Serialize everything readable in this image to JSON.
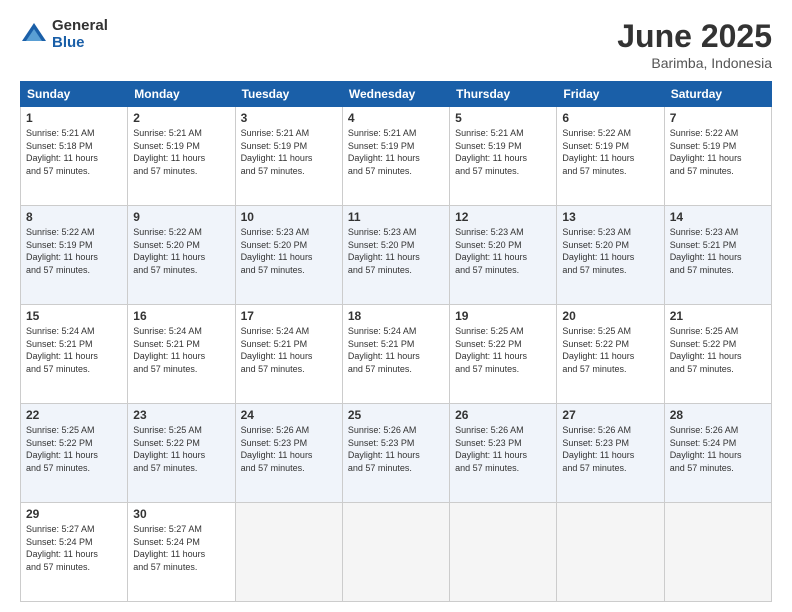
{
  "logo": {
    "general": "General",
    "blue": "Blue"
  },
  "title": "June 2025",
  "subtitle": "Barimba, Indonesia",
  "headers": [
    "Sunday",
    "Monday",
    "Tuesday",
    "Wednesday",
    "Thursday",
    "Friday",
    "Saturday"
  ],
  "weeks": [
    [
      {
        "day": "1",
        "info": "Sunrise: 5:21 AM\nSunset: 5:18 PM\nDaylight: 11 hours\nand 57 minutes."
      },
      {
        "day": "2",
        "info": "Sunrise: 5:21 AM\nSunset: 5:19 PM\nDaylight: 11 hours\nand 57 minutes."
      },
      {
        "day": "3",
        "info": "Sunrise: 5:21 AM\nSunset: 5:19 PM\nDaylight: 11 hours\nand 57 minutes."
      },
      {
        "day": "4",
        "info": "Sunrise: 5:21 AM\nSunset: 5:19 PM\nDaylight: 11 hours\nand 57 minutes."
      },
      {
        "day": "5",
        "info": "Sunrise: 5:21 AM\nSunset: 5:19 PM\nDaylight: 11 hours\nand 57 minutes."
      },
      {
        "day": "6",
        "info": "Sunrise: 5:22 AM\nSunset: 5:19 PM\nDaylight: 11 hours\nand 57 minutes."
      },
      {
        "day": "7",
        "info": "Sunrise: 5:22 AM\nSunset: 5:19 PM\nDaylight: 11 hours\nand 57 minutes."
      }
    ],
    [
      {
        "day": "8",
        "info": "Sunrise: 5:22 AM\nSunset: 5:19 PM\nDaylight: 11 hours\nand 57 minutes."
      },
      {
        "day": "9",
        "info": "Sunrise: 5:22 AM\nSunset: 5:20 PM\nDaylight: 11 hours\nand 57 minutes."
      },
      {
        "day": "10",
        "info": "Sunrise: 5:23 AM\nSunset: 5:20 PM\nDaylight: 11 hours\nand 57 minutes."
      },
      {
        "day": "11",
        "info": "Sunrise: 5:23 AM\nSunset: 5:20 PM\nDaylight: 11 hours\nand 57 minutes."
      },
      {
        "day": "12",
        "info": "Sunrise: 5:23 AM\nSunset: 5:20 PM\nDaylight: 11 hours\nand 57 minutes."
      },
      {
        "day": "13",
        "info": "Sunrise: 5:23 AM\nSunset: 5:20 PM\nDaylight: 11 hours\nand 57 minutes."
      },
      {
        "day": "14",
        "info": "Sunrise: 5:23 AM\nSunset: 5:21 PM\nDaylight: 11 hours\nand 57 minutes."
      }
    ],
    [
      {
        "day": "15",
        "info": "Sunrise: 5:24 AM\nSunset: 5:21 PM\nDaylight: 11 hours\nand 57 minutes."
      },
      {
        "day": "16",
        "info": "Sunrise: 5:24 AM\nSunset: 5:21 PM\nDaylight: 11 hours\nand 57 minutes."
      },
      {
        "day": "17",
        "info": "Sunrise: 5:24 AM\nSunset: 5:21 PM\nDaylight: 11 hours\nand 57 minutes."
      },
      {
        "day": "18",
        "info": "Sunrise: 5:24 AM\nSunset: 5:21 PM\nDaylight: 11 hours\nand 57 minutes."
      },
      {
        "day": "19",
        "info": "Sunrise: 5:25 AM\nSunset: 5:22 PM\nDaylight: 11 hours\nand 57 minutes."
      },
      {
        "day": "20",
        "info": "Sunrise: 5:25 AM\nSunset: 5:22 PM\nDaylight: 11 hours\nand 57 minutes."
      },
      {
        "day": "21",
        "info": "Sunrise: 5:25 AM\nSunset: 5:22 PM\nDaylight: 11 hours\nand 57 minutes."
      }
    ],
    [
      {
        "day": "22",
        "info": "Sunrise: 5:25 AM\nSunset: 5:22 PM\nDaylight: 11 hours\nand 57 minutes."
      },
      {
        "day": "23",
        "info": "Sunrise: 5:25 AM\nSunset: 5:22 PM\nDaylight: 11 hours\nand 57 minutes."
      },
      {
        "day": "24",
        "info": "Sunrise: 5:26 AM\nSunset: 5:23 PM\nDaylight: 11 hours\nand 57 minutes."
      },
      {
        "day": "25",
        "info": "Sunrise: 5:26 AM\nSunset: 5:23 PM\nDaylight: 11 hours\nand 57 minutes."
      },
      {
        "day": "26",
        "info": "Sunrise: 5:26 AM\nSunset: 5:23 PM\nDaylight: 11 hours\nand 57 minutes."
      },
      {
        "day": "27",
        "info": "Sunrise: 5:26 AM\nSunset: 5:23 PM\nDaylight: 11 hours\nand 57 minutes."
      },
      {
        "day": "28",
        "info": "Sunrise: 5:26 AM\nSunset: 5:24 PM\nDaylight: 11 hours\nand 57 minutes."
      }
    ],
    [
      {
        "day": "29",
        "info": "Sunrise: 5:27 AM\nSunset: 5:24 PM\nDaylight: 11 hours\nand 57 minutes."
      },
      {
        "day": "30",
        "info": "Sunrise: 5:27 AM\nSunset: 5:24 PM\nDaylight: 11 hours\nand 57 minutes."
      },
      {
        "day": "",
        "info": ""
      },
      {
        "day": "",
        "info": ""
      },
      {
        "day": "",
        "info": ""
      },
      {
        "day": "",
        "info": ""
      },
      {
        "day": "",
        "info": ""
      }
    ]
  ]
}
